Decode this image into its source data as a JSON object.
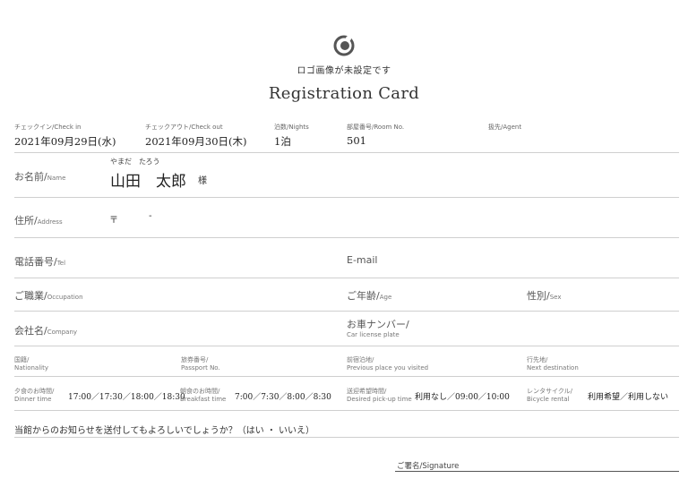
{
  "logo": {
    "placeholder_text": "ロゴ画像が未設定です",
    "icon": "logo-placeholder-icon"
  },
  "title": "Registration Card",
  "stay": {
    "checkin_label": "チェックイン/Check in",
    "checkin_value": "2021年09月29日(水)",
    "checkout_label": "チェックアウト/Check out",
    "checkout_value": "2021年09月30日(木)",
    "nights_label": "泊数/Nights",
    "nights_value": "1泊",
    "room_label": "部屋番号/Room No.",
    "room_value": "501",
    "agent_label": "扱先/Agent"
  },
  "name": {
    "label_jp": "お名前/",
    "label_en": "Name",
    "furigana": "やまだ　たろう",
    "value": "山田　太郎",
    "honorific": "様"
  },
  "address": {
    "label_jp": "住所/",
    "label_en": "Address",
    "postal_mark": "〒",
    "postal_dash": "-"
  },
  "phone": {
    "label_jp": "電話番号/",
    "label_en": "Tel"
  },
  "email": {
    "label": "E-mail"
  },
  "occupation": {
    "label_jp": "ご職業/",
    "label_en": "Occupation"
  },
  "age": {
    "label_jp": "ご年齢/",
    "label_en": "Age"
  },
  "sex": {
    "label_jp": "性別/",
    "label_en": "Sex"
  },
  "company": {
    "label_jp": "会社名/",
    "label_en": "Company"
  },
  "car": {
    "label_jp": "お車ナンバー/",
    "label_en": "Car license plate"
  },
  "nationality": {
    "label_jp": "国籍/",
    "label_en": "Nationality"
  },
  "passport": {
    "label_jp": "旅券番号/",
    "label_en": "Passport No."
  },
  "previous_place": {
    "label_jp": "前宿泊地/",
    "label_en": "Previous place you visited"
  },
  "next_destination": {
    "label_jp": "行先地/",
    "label_en": "Next destination"
  },
  "dinner": {
    "label_jp": "夕食のお時間/",
    "label_en": "Dinner time",
    "options": "17:00／17:30／18:00／18:30"
  },
  "breakfast": {
    "label_jp": "朝食のお時間/",
    "label_en": "Breakfast time",
    "options": "7:00／7:30／8:00／8:30"
  },
  "pickup": {
    "label_jp": "送迎希望時間/",
    "label_en": "Desired pick-up time",
    "options": "利用なし／09:00／10:00"
  },
  "bicycle": {
    "label_jp": "レンタサイクル/",
    "label_en": "Bicycle rental",
    "options": "利用希望／利用しない"
  },
  "notice_question": "当館からのお知らせを送付してもよろしいでしょうか？（はい ・ いいえ）",
  "signature_label": "ご署名/Signature"
}
